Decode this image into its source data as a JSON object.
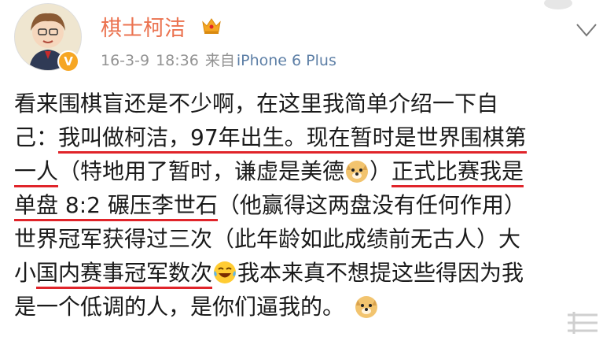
{
  "user": {
    "name": "棋士柯洁",
    "verified_badge": "V",
    "crown_icon": "crown-icon"
  },
  "meta": {
    "date": "16-3-9",
    "time": "18:36",
    "source_prefix": "来自",
    "source": "iPhone 6 Plus"
  },
  "post": {
    "l1": "看来围棋盲还是不少啊，在这里我简单介绍一下自",
    "l2a": "己：",
    "l2b": "我叫做柯洁，97年出生。现在暂时是世界围棋第",
    "l3a": "一人",
    "l3b": "（特地用了暂时，谦虚是美德",
    "l3c": "）",
    "l3d": "正式比赛我是",
    "l4a": "单盘 8:2 碾压李世石",
    "l4b": "（他赢得这两盘没有任何作用）",
    "l5": "世界冠军获得过三次（此年龄如此成绩前无古人）大",
    "l6a": "小",
    "l6b": "国内赛事冠军数次",
    "l6c": "我本来真不想提这些得因为我",
    "l7": "是一个低调的人，是你们逼我的。"
  },
  "emojis": [
    "doge-emoji",
    "laugh-cry-emoji",
    "doge-emoji"
  ],
  "colors": {
    "username": "#eb7350",
    "underline": "#e0242a",
    "meta": "#939393",
    "source": "#5d7fa6",
    "badge": "#f6a623"
  }
}
